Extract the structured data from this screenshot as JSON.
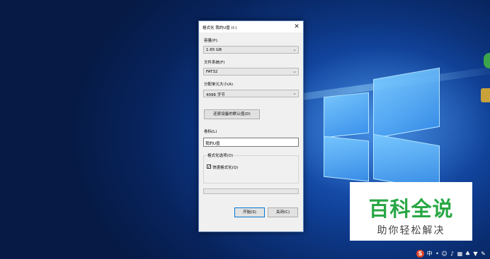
{
  "dialog": {
    "title": "格式化 我的U盘 (I:)",
    "capacity_label": "容量(P):",
    "capacity_value": "1.65 GB",
    "filesystem_label": "文件系统(F)",
    "filesystem_value": "FAT32",
    "allocation_label": "分配单元大小(A)",
    "allocation_value": "4096 字节",
    "restore_button": "还原设备的默认值(D)",
    "volume_label": "卷标(L)",
    "volume_value": "我的U盘",
    "format_options_title": "格式化选项(O)",
    "quick_format_label": "快速格式化(Q)",
    "quick_format_checked": true,
    "progress": 0,
    "start_button": "开始(S)",
    "close_button": "关闭(C)"
  },
  "watermark": {
    "main": "百科全说",
    "sub": "助你轻松解决"
  },
  "tray": {
    "ime_glyph": "S",
    "ime_mode": "中"
  }
}
